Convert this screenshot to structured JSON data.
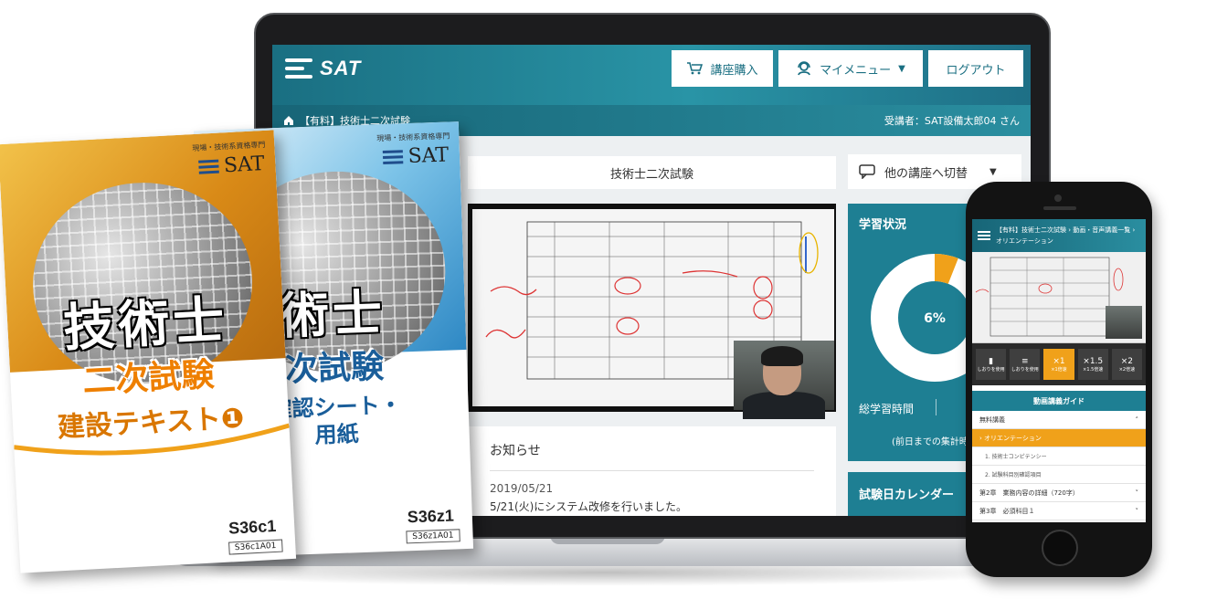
{
  "app": {
    "brand": "SAT",
    "header": {
      "buy_label": "講座購入",
      "menu_label": "マイメニュー",
      "logout_label": "ログアウト"
    },
    "breadcrumb": "【有料】技術士二次試験",
    "user": "受講者：SAT設備太郎04 さん",
    "course_title": "技術士二次試験",
    "switch_label": "他の講座へ切替",
    "progress": {
      "title": "学習状況",
      "percent_label": "6%",
      "percent": 0.06,
      "total_label": "総学習時間",
      "note": "(前日までの集計時"
    },
    "calendar_title": "試験日カレンダー",
    "notice": {
      "title": "お知らせ",
      "date": "2019/05/21",
      "message": "5/21(火)にシステム改修を行いました。"
    }
  },
  "books": {
    "front": {
      "kicker": "現場・技術系資格専門",
      "brand": "SAT",
      "line1": "技術士",
      "line2": "二次試験",
      "line3": "建設テキスト❶",
      "code": "S36c1",
      "subcode": "S36c1A01"
    },
    "back": {
      "kicker": "現場・技術系資格専門",
      "brand": "SAT",
      "line1": "術士",
      "line2": "次試験",
      "line3": "確認シート・",
      "line4": "用紙",
      "code": "S36z1",
      "subcode": "S36z1A01"
    }
  },
  "phone": {
    "breadcrumb": "【有料】技術士二次試験 › 動画・音声講義一覧 ›",
    "subtitle": "オリエンテーション",
    "controls": [
      {
        "label": "",
        "sub": "しおりを使用"
      },
      {
        "label": "",
        "sub": "しおりを使用"
      },
      {
        "label": "×1",
        "sub": "×1倍速"
      },
      {
        "label": "×1.5",
        "sub": "×1.5倍速"
      },
      {
        "label": "×2",
        "sub": "×2倍速"
      }
    ],
    "guide_title": "動画講義ガイド",
    "section_free": "無料講義",
    "item_active": "オリエンテーション",
    "item_1": "1. 技術士コンピテンシー",
    "item_2": "2. 試験科目別確認項目",
    "chapter2": "第2章　業務内容の詳細（720字）",
    "chapter3": "第3章　必須科目１"
  }
}
